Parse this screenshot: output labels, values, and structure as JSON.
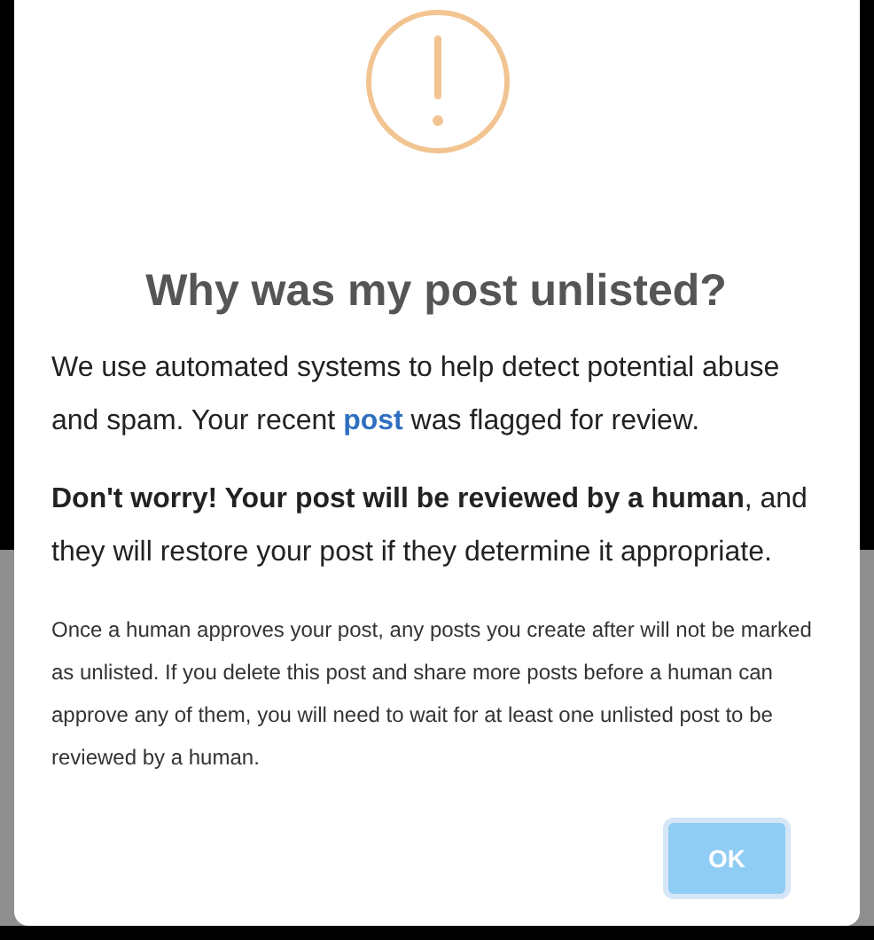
{
  "dialog": {
    "title": "Why was my post unlisted?",
    "intro": {
      "before": "We use automated systems to help detect potential abuse and spam. Your recent ",
      "link": "post",
      "after": " was flagged for review."
    },
    "reassurance": "**Don't worry! Your post will be reviewed by a human**, and they will restore your post if they determine it appropriate.",
    "note": "Once a human approves your post, any posts you create after will not be marked as unlisted. If you delete this post and share more posts before a human can approve any of them, you will need to wait for at least one unlisted post to be reviewed by a human.",
    "buttons": [
      {
        "label": "OK",
        "disabled": true
      }
    ]
  }
}
